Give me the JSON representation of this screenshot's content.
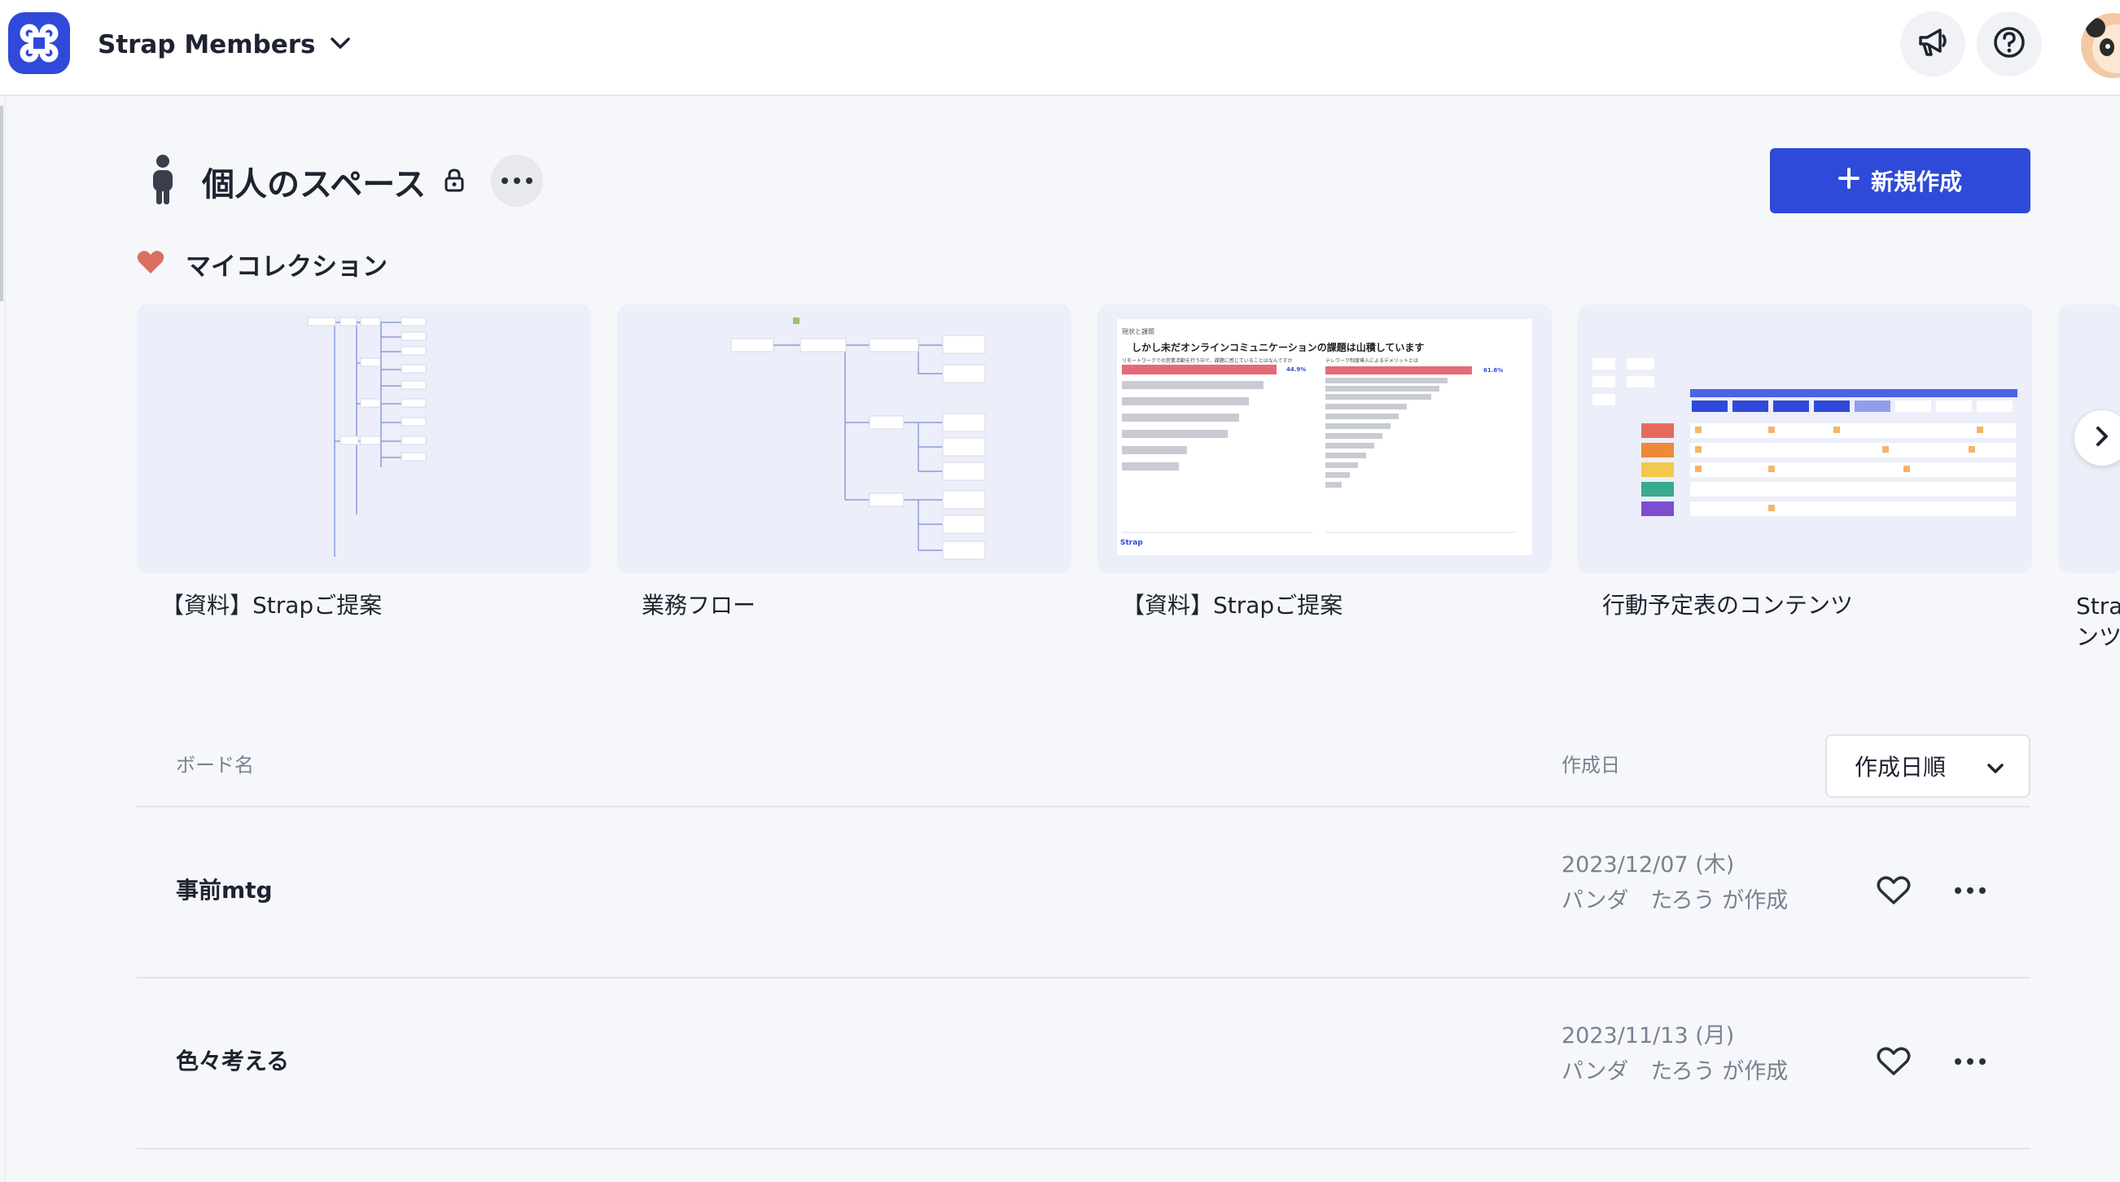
{
  "header": {
    "workspace_name": "Strap Members"
  },
  "space": {
    "title": "個人のスペース",
    "new_button_label": "新規作成"
  },
  "collection": {
    "title": "マイコレクション",
    "cards": [
      {
        "title": "【資料】Strapご提案"
      },
      {
        "title": "業務フロー"
      },
      {
        "title": "【資料】Strapご提案"
      },
      {
        "title": "行動予定表のコンテンツ"
      },
      {
        "title": "Strapンツ"
      }
    ],
    "slide_preview": {
      "section": "現状と課題",
      "headline": "しかし未だオンラインコミュニケーションの課題は山積しています",
      "left_subtitle": "リモートワークでの営業活動を行う中で、課題に感じていることはなんですか",
      "right_subtitle": "テレワーク制度導入によるデメリットとは",
      "left_pct": "44.9%",
      "right_pct": "61.6%",
      "brand": "Strap"
    }
  },
  "list": {
    "col_board": "ボード名",
    "col_date": "作成日",
    "sort_label": "作成日順",
    "rows": [
      {
        "name": "事前mtg",
        "date": "2023/12/07 (木)",
        "creator": "パンダ　たろう が作成"
      },
      {
        "name": "色々考える",
        "date": "2023/11/13 (月)",
        "creator": "パンダ　たろう が作成"
      }
    ]
  },
  "colors": {
    "brand": "#2f4ad9",
    "heart": "#d9705f",
    "background": "#f6f7fb"
  }
}
